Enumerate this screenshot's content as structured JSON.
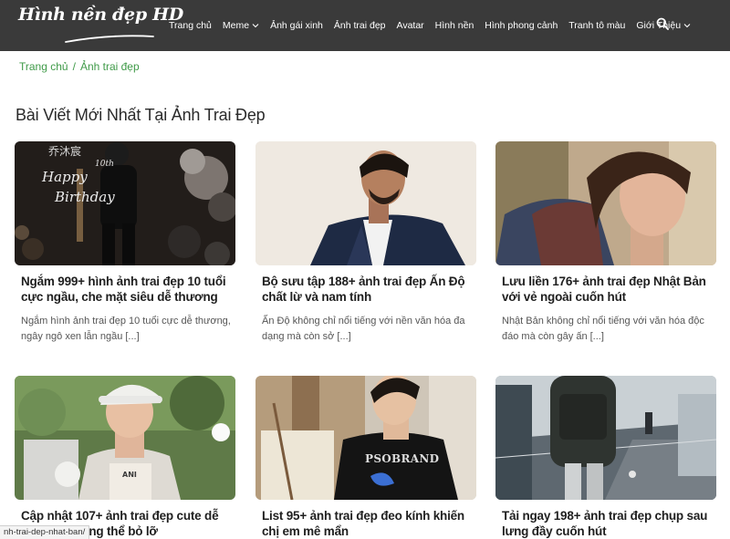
{
  "site": {
    "logo_text": "Hình nền đẹp HD",
    "nav": [
      {
        "label": "Trang chủ",
        "dropdown": false
      },
      {
        "label": "Meme",
        "dropdown": true
      },
      {
        "label": "Ảnh gái xinh",
        "dropdown": false
      },
      {
        "label": "Ảnh trai đẹp",
        "dropdown": false
      },
      {
        "label": "Avatar",
        "dropdown": false
      },
      {
        "label": "Hình nền",
        "dropdown": false
      },
      {
        "label": "Hình phong cảnh",
        "dropdown": false
      },
      {
        "label": "Tranh tô màu",
        "dropdown": false
      },
      {
        "label": "Giới Thiệu",
        "dropdown": true
      }
    ],
    "search_icon": "search-icon"
  },
  "breadcrumb": {
    "home": "Trang chủ",
    "separator": "/",
    "current": "Ảnh trai đẹp"
  },
  "page_title": "Bài Viết Mới Nhất Tại Ảnh Trai Đẹp",
  "posts": [
    {
      "title": "Ngắm 999+ hình ảnh trai đẹp 10 tuổi cực ngầu, che mặt siêu dễ thương",
      "excerpt": "Ngắm hình ảnh trai đẹp 10 tuổi cực dễ thương, ngây ngô xen lẫn ngầu [...]",
      "image_text_1": "乔沐宸",
      "image_text_2": "10th",
      "image_text_3": "Happy",
      "image_text_4": "Birthday"
    },
    {
      "title": "Bộ sưu tập 188+ ảnh trai đẹp Ấn Độ chất lừ và nam tính",
      "excerpt": "Ấn Độ không chỉ nổi tiếng với nền văn hóa đa dạng mà còn sở [...]"
    },
    {
      "title": "Lưu liền 176+ ảnh trai đẹp Nhật Bản với vẻ ngoài cuốn hút",
      "excerpt": "Nhật Bản không chỉ nổi tiếng với văn hóa độc đáo mà còn gây ấn [...]"
    },
    {
      "title": "Cập nhật 107+ ảnh trai đẹp cute dễ thương không thể bỏ lỡ",
      "excerpt": "",
      "image_text_1": "ANI"
    },
    {
      "title": "List 95+ ảnh trai đẹp đeo kính khiến chị em mê mẩn",
      "excerpt": "",
      "image_text_1": "PSOBRAND"
    },
    {
      "title": "Tải ngay 198+ ảnh trai đẹp chụp sau lưng đầy cuốn hút",
      "excerpt": ""
    }
  ],
  "status_url": "nh-trai-dep-nhat-ban/",
  "colors": {
    "header_bg": "#3a3a3a",
    "accent_green": "#3f9a48",
    "text_dark": "#1f1f1f",
    "text_muted": "#555555"
  }
}
